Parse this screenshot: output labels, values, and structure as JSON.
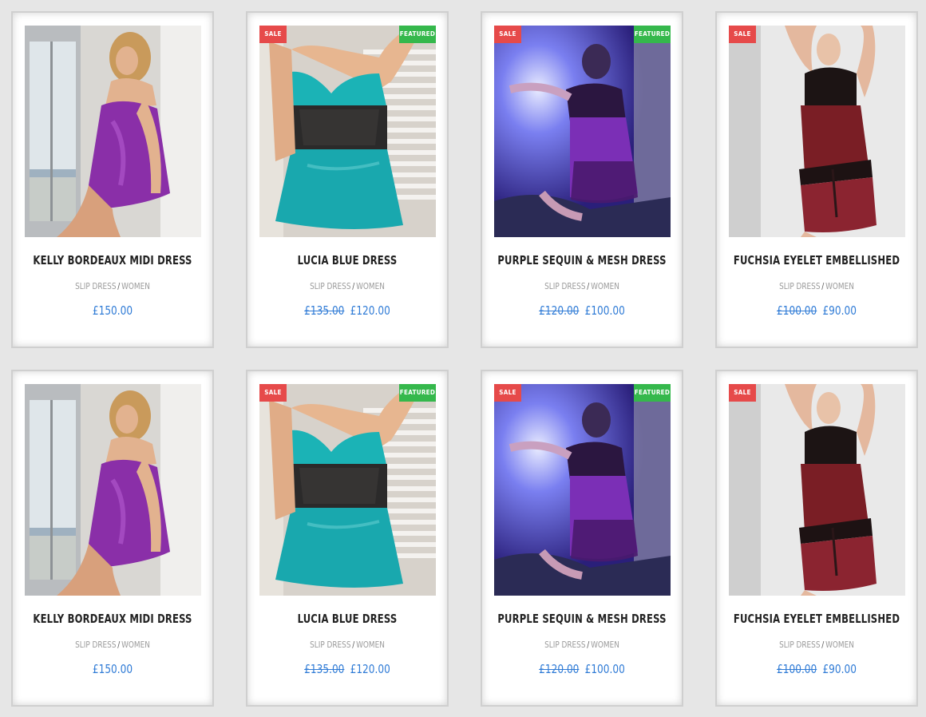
{
  "colors": {
    "page_bg": "#e6e6e6",
    "card_bg": "#ffffff",
    "price": "#2f7bd6",
    "sale_badge": "#e64a4a",
    "featured_badge": "#35b84c",
    "title": "#222222",
    "category": "#9a9a9a"
  },
  "products": [
    {
      "name": "KELLY BORDEAUX MIDI DRESS",
      "category": "SLIP DRESS",
      "subcategory": "WOMEN",
      "old_price": "",
      "price": "£150.00",
      "sale_badge": "",
      "featured_badge": "",
      "image": "model-purple-slip-dress"
    },
    {
      "name": "LUCIA BLUE DRESS",
      "category": "SLIP DRESS",
      "subcategory": "WOMEN",
      "old_price": "£135.00",
      "price": "£120.00",
      "sale_badge": "SALE",
      "featured_badge": "FEATURED",
      "image": "model-teal-lace-dress"
    },
    {
      "name": "PURPLE SEQUIN & MESH DRESS",
      "category": "SLIP DRESS",
      "subcategory": "WOMEN",
      "old_price": "£120.00",
      "price": "£100.00",
      "sale_badge": "SALE",
      "featured_badge": "FEATURED",
      "image": "model-purple-sequin-dress"
    },
    {
      "name": "FUCHSIA EYELET EMBELLISHED",
      "category": "SLIP DRESS",
      "subcategory": "WOMEN",
      "old_price": "£100.00",
      "price": "£90.00",
      "sale_badge": "SALE",
      "featured_badge": "",
      "image": "model-burgundy-slip-dress"
    },
    {
      "name": "KELLY BORDEAUX MIDI DRESS",
      "category": "SLIP DRESS",
      "subcategory": "WOMEN",
      "old_price": "",
      "price": "£150.00",
      "sale_badge": "",
      "featured_badge": "",
      "image": "model-purple-slip-dress"
    },
    {
      "name": "LUCIA BLUE DRESS",
      "category": "SLIP DRESS",
      "subcategory": "WOMEN",
      "old_price": "£135.00",
      "price": "£120.00",
      "sale_badge": "SALE",
      "featured_badge": "FEATURED",
      "image": "model-teal-lace-dress"
    },
    {
      "name": "PURPLE SEQUIN & MESH DRESS",
      "category": "SLIP DRESS",
      "subcategory": "WOMEN",
      "old_price": "£120.00",
      "price": "£100.00",
      "sale_badge": "SALE",
      "featured_badge": "FEATURED",
      "image": "model-purple-sequin-dress"
    },
    {
      "name": "FUCHSIA EYELET EMBELLISHED",
      "category": "SLIP DRESS",
      "subcategory": "WOMEN",
      "old_price": "£100.00",
      "price": "£90.00",
      "sale_badge": "SALE",
      "featured_badge": "",
      "image": "model-burgundy-slip-dress"
    }
  ]
}
